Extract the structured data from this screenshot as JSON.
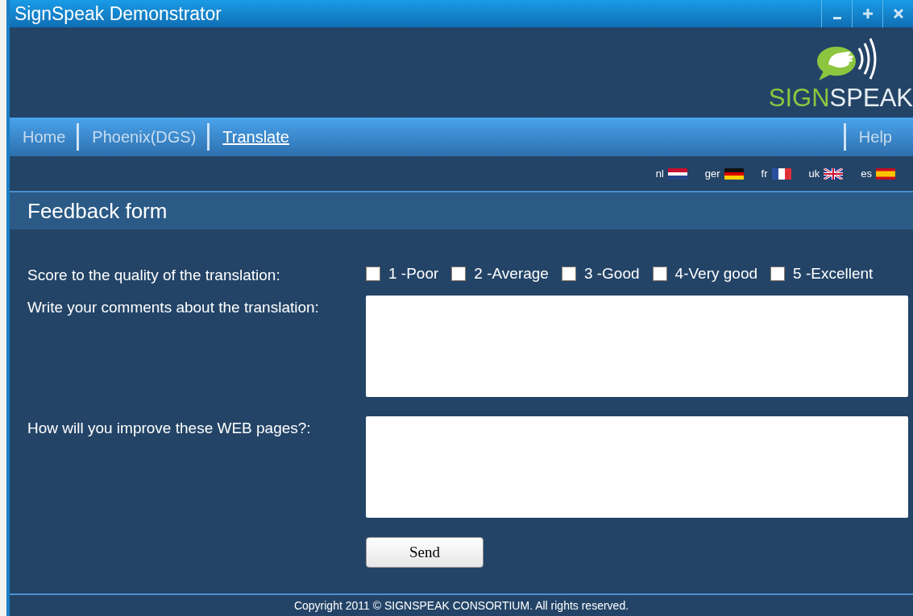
{
  "window": {
    "title": "SignSpeak Demonstrator",
    "controls": [
      {
        "kind": "minimize"
      },
      {
        "kind": "maximize"
      },
      {
        "kind": "close"
      }
    ]
  },
  "logo": {
    "part_1": "SIGN",
    "part_2": "SPEAK"
  },
  "nav": {
    "items": [
      {
        "label": "Home",
        "selected": false
      },
      {
        "label": "Phoenix(DGS)",
        "selected": false
      },
      {
        "label": "Translate",
        "selected": true
      }
    ],
    "right": [
      {
        "label": "Help",
        "selected": false
      }
    ]
  },
  "languages": [
    {
      "label": "nl",
      "kind": "nl"
    },
    {
      "label": "ger",
      "kind": "de"
    },
    {
      "label": "fr",
      "kind": "fr"
    },
    {
      "label": "uk",
      "kind": "uk"
    },
    {
      "label": "es",
      "kind": "es"
    }
  ],
  "form": {
    "title": "Feedback form",
    "score": {
      "label": "Score to the quality of the translation:",
      "options": [
        {
          "label": "1 -Poor",
          "checked": false
        },
        {
          "label": "2 -Average",
          "checked": false
        },
        {
          "label": "3 -Good",
          "checked": false
        },
        {
          "label": "4-Very good",
          "checked": false
        },
        {
          "label": "5 -Excellent",
          "checked": false
        }
      ]
    },
    "fields": [
      {
        "label": "Write your comments about the translation:"
      },
      {
        "label": "How will you improve these WEB pages?:"
      }
    ],
    "submit": "Send"
  },
  "footer": "Copyright 2011 © SIGNSPEAK CONSORTIUM. All rights reserved."
}
